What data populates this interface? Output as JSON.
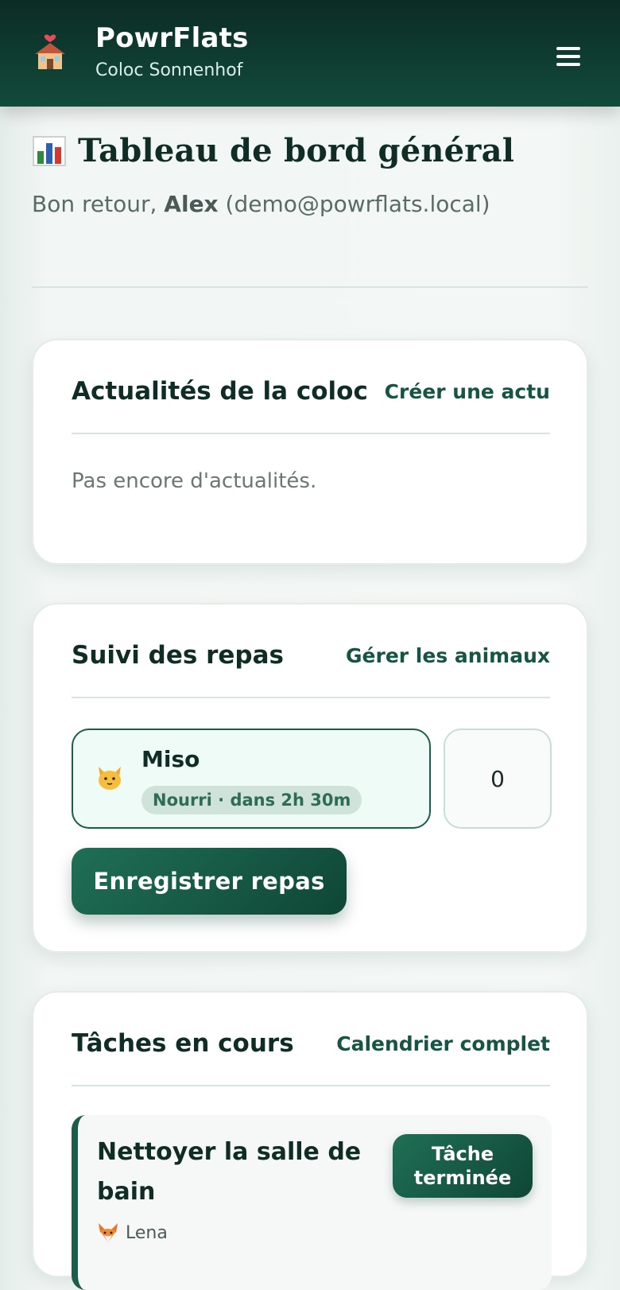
{
  "header": {
    "app_name": "PowrFlats",
    "flat_name": "Coloc Sonnenhof",
    "icon": "house-icon",
    "menu_icon": "hamburger-menu-icon"
  },
  "dashboard": {
    "title": "Tableau de bord général",
    "title_icon": "bar-chart-icon",
    "greeting_prefix": "Bon retour,",
    "user_name": "Alex",
    "user_email": "(demo@powrflats.local)"
  },
  "news": {
    "title": "Actualités de la coloc",
    "link_label": "Créer une actu",
    "empty_text": "Pas encore d'actualités."
  },
  "meals": {
    "title": "Suivi des repas",
    "link_label": "Gérer les animaux",
    "pets": [
      {
        "name": "Miso",
        "icon": "cat-icon",
        "status": "Nourri · dans 2h 30m"
      }
    ],
    "count": "0",
    "button_label": "Enregistrer repas"
  },
  "tasks": {
    "title": "Tâches en cours",
    "link_label": "Calendrier complet",
    "items": [
      {
        "name": "Nettoyer la salle de bain",
        "assignee": "Lena",
        "assignee_icon": "fox-icon",
        "button_label": "Tâche terminée"
      }
    ]
  },
  "colors": {
    "header_bg": "#0b2b24",
    "accent": "#1d5c49",
    "pet_card_bg": "#effbf6",
    "status_pill_bg": "#cfe3da"
  }
}
